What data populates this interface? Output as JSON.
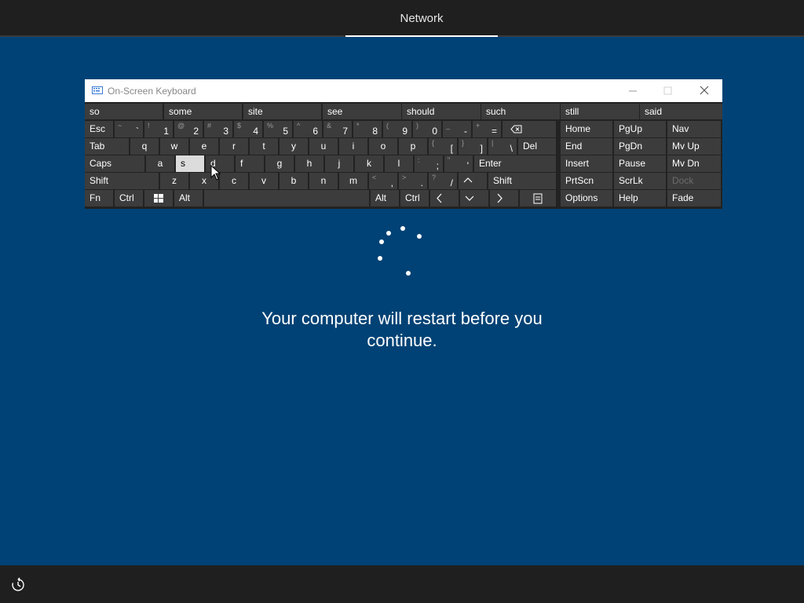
{
  "header": {
    "tab_label": "Network"
  },
  "osk": {
    "title": "On-Screen Keyboard",
    "predictions": [
      "so",
      "some",
      "site",
      "see",
      "should",
      "such",
      "still",
      "said"
    ],
    "rows": {
      "r1": [
        "Esc",
        "~",
        "`",
        "!",
        "1",
        "@",
        "2",
        "#",
        "3",
        "$",
        "4",
        "%",
        "5",
        "^",
        "6",
        "&",
        "7",
        "*",
        "8",
        "(",
        "9",
        ")",
        "0",
        "_",
        "-",
        "+",
        "="
      ],
      "r2": [
        "Tab",
        "q",
        "w",
        "e",
        "r",
        "t",
        "y",
        "u",
        "i",
        "o",
        "p",
        "{",
        "[",
        "}",
        "]",
        "|",
        "\\",
        "Del"
      ],
      "r3": [
        "Caps",
        "a",
        "s",
        "d",
        "f",
        "g",
        "h",
        "j",
        "k",
        "l",
        ":",
        ";",
        "\"",
        "'",
        "Enter"
      ],
      "r4": [
        "Shift",
        "z",
        "x",
        "c",
        "v",
        "b",
        "n",
        "m",
        "<",
        ",",
        ">",
        ".",
        "?",
        "/",
        "Shift"
      ],
      "r5": [
        "Fn",
        "Ctrl",
        "Alt",
        "Alt",
        "Ctrl"
      ]
    },
    "nav": {
      "col1": [
        "Home",
        "End",
        "Insert",
        "PrtScn",
        "Options"
      ],
      "col2": [
        "PgUp",
        "PgDn",
        "Pause",
        "ScrLk",
        "Help"
      ],
      "col3": [
        "Nav",
        "Mv Up",
        "Mv Dn",
        "Dock",
        "Fade"
      ]
    }
  },
  "message": "Your computer will restart before you continue.",
  "icons": {
    "keyboard": "keyboard-icon",
    "minimize": "minimize-icon",
    "maximize": "maximize-icon",
    "close": "close-icon",
    "backspace": "backspace-icon",
    "windows": "windows-logo-icon",
    "up": "arrow-up-icon",
    "down": "arrow-down-icon",
    "left": "arrow-left-icon",
    "right": "arrow-right-icon",
    "menu": "context-menu-icon",
    "power": "accessibility-icon",
    "spinner": "loading-spinner-icon",
    "cursor": "mouse-pointer-icon"
  },
  "colors": {
    "background": "#004275",
    "bar": "#1f1f1f",
    "key": "#3c3c3c",
    "key_pressed": "#dcdcdc"
  }
}
